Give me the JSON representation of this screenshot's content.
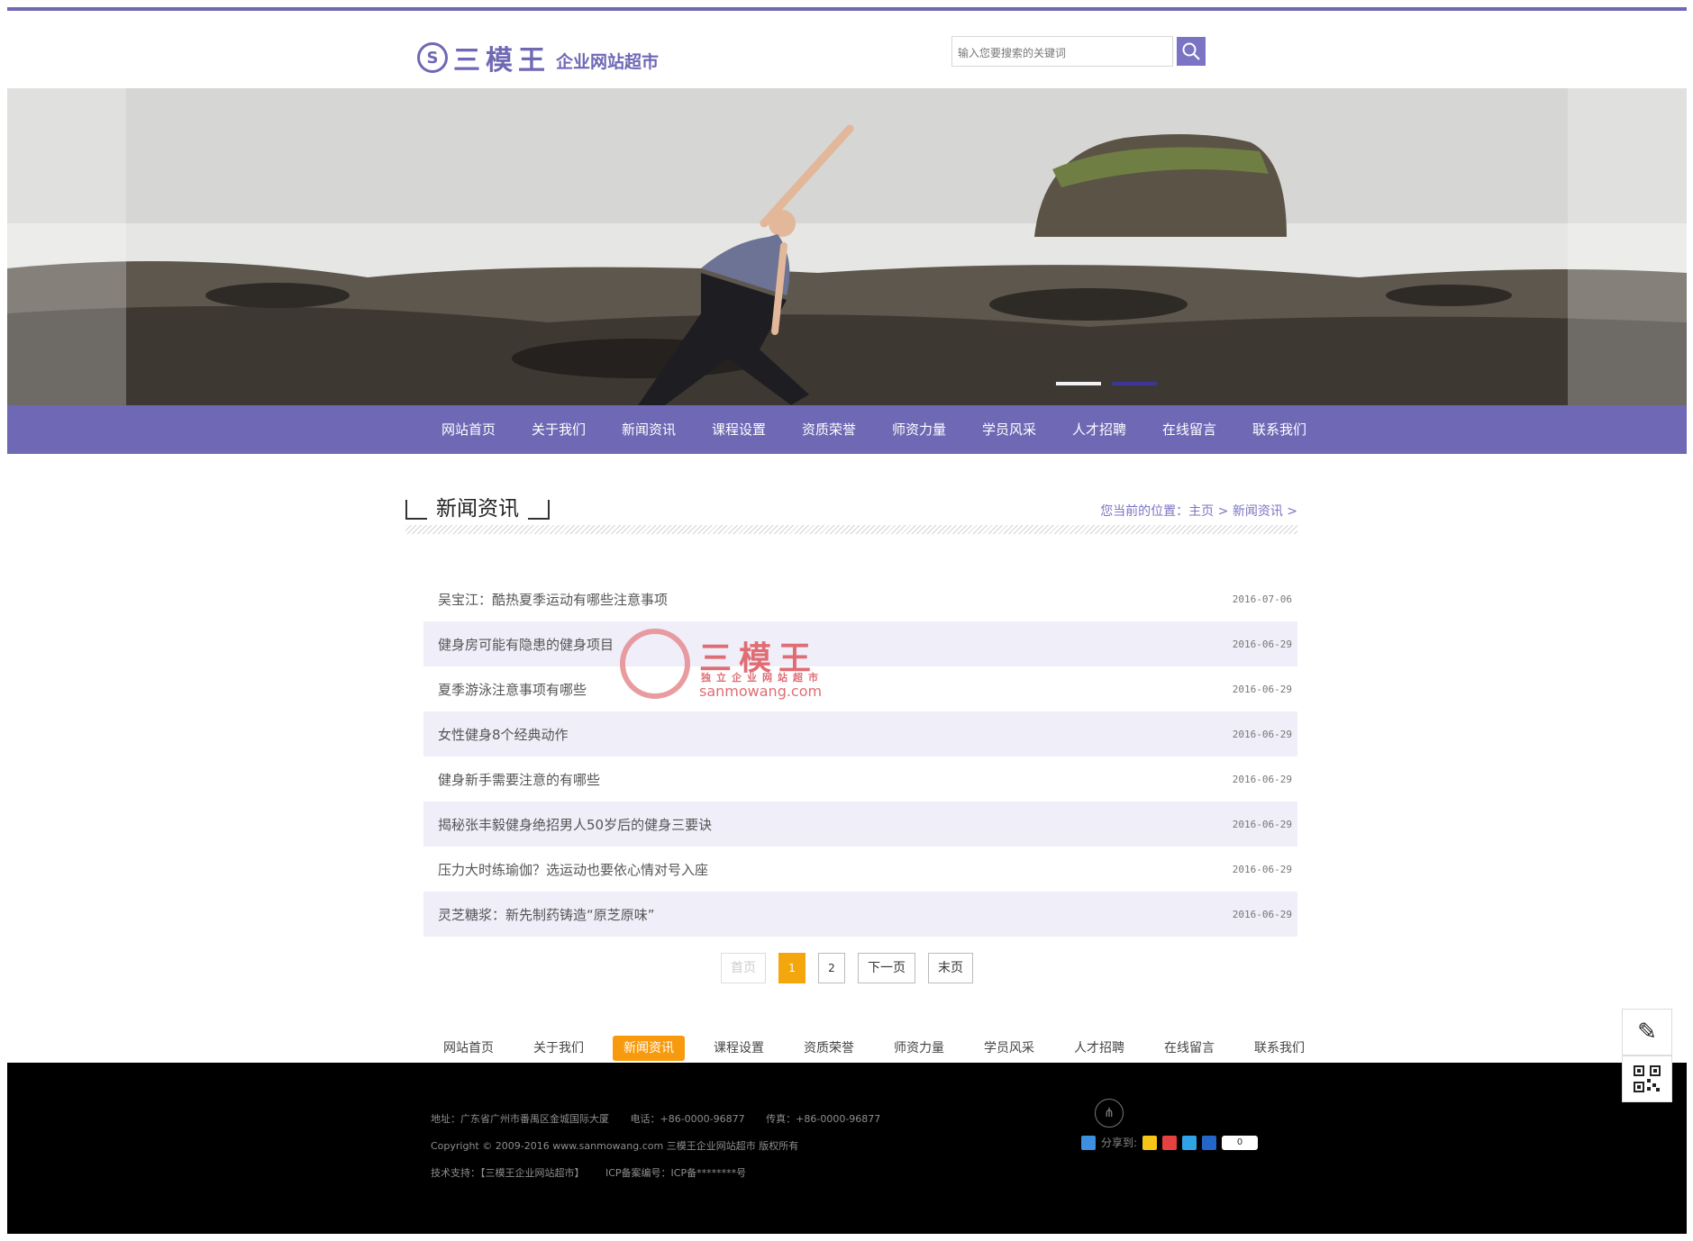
{
  "brand": {
    "name": "三模王",
    "subtitle": "企业网站超市"
  },
  "search": {
    "placeholder": "输入您要搜索的关键词"
  },
  "colors": {
    "primary": "#6f68b5",
    "accent": "#f79a0e",
    "row_alt": "#efeef9",
    "footer": "#000000"
  },
  "nav": [
    "网站首页",
    "关于我们",
    "新闻资讯",
    "课程设置",
    "资质荣誉",
    "师资力量",
    "学员风采",
    "人才招聘",
    "在线留言",
    "联系我们"
  ],
  "section": {
    "title": "新闻资讯",
    "breadcrumb": "您当前的位置：主页 > 新闻资讯 >"
  },
  "news": [
    {
      "title": "吴宝江：酷热夏季运动有哪些注意事项",
      "date": "2016-07-06"
    },
    {
      "title": "健身房可能有隐患的健身项目",
      "date": "2016-06-29"
    },
    {
      "title": "夏季游泳注意事项有哪些",
      "date": "2016-06-29"
    },
    {
      "title": "女性健身8个经典动作",
      "date": "2016-06-29"
    },
    {
      "title": "健身新手需要注意的有哪些",
      "date": "2016-06-29"
    },
    {
      "title": "揭秘张丰毅健身绝招男人50岁后的健身三要诀",
      "date": "2016-06-29"
    },
    {
      "title": "压力大时练瑜伽？选运动也要依心情对号入座",
      "date": "2016-06-29"
    },
    {
      "title": "灵芝糖浆：新先制药铸造“原芝原味”",
      "date": "2016-06-29"
    }
  ],
  "watermark": {
    "brand": "三模王",
    "sub": "独立企业网站超市",
    "url": "sanmowang.com"
  },
  "pager": {
    "first": "首页",
    "current": "1",
    "page2": "2",
    "next": "下一页",
    "last": "末页"
  },
  "bottom_nav": {
    "items": [
      "网站首页",
      "关于我们",
      "新闻资讯",
      "课程设置",
      "资质荣誉",
      "师资力量",
      "学员风采",
      "人才招聘",
      "在线留言",
      "联系我们"
    ],
    "active": "新闻资讯"
  },
  "footer": {
    "address": "地址：广东省广州市番禺区金城国际大厦",
    "phone": "电话：+86-0000-96877",
    "fax": "传真：+86-0000-96877",
    "copyright": "Copyright © 2009-2016 www.sanmowang.com 三模王企业网站超市 版权所有",
    "support": "技术支持：【三模王企业网站超市】",
    "icp": "ICP备案编号：ICP备********号",
    "share_label": "分享到:",
    "share_count": "0"
  },
  "icons": [
    "search-icon",
    "sitemap-icon",
    "edit-icon",
    "qrcode-icon"
  ]
}
